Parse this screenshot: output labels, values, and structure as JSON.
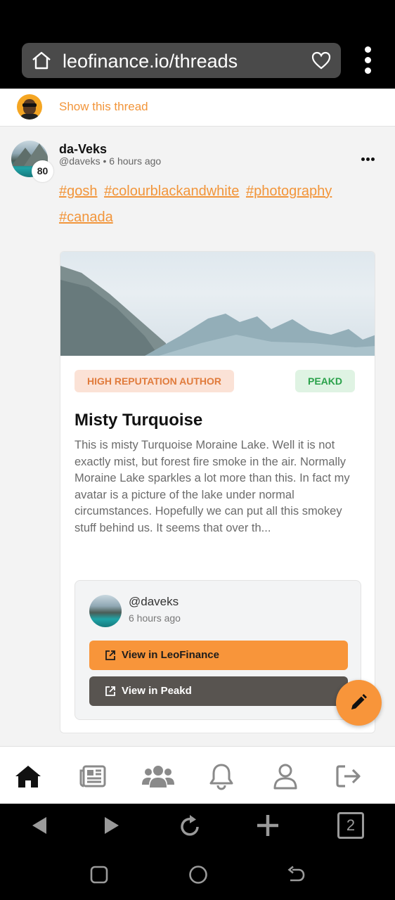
{
  "browser": {
    "url": "leofinance.io/threads",
    "tab_count": "2"
  },
  "thread_link": {
    "label": "Show this thread"
  },
  "post": {
    "author_name": "da-Veks",
    "author_handle": "@daveks",
    "separator": "•",
    "time_ago": "6 hours ago",
    "reputation": "80",
    "tags": [
      "#gosh",
      "#colourblackandwhite",
      "#photography",
      "#canada"
    ]
  },
  "card": {
    "badge_reputation": "HIGH REPUTATION AUTHOR",
    "badge_source": "PEAKD",
    "title": "Misty Turquoise",
    "body": "This is misty Turquoise Moraine Lake. Well it is not exactly mist, but forest fire smoke in the air. Normally Moraine Lake sparkles a lot more than this. In fact my avatar is a picture of the lake under normal circumstances. Hopefully we can put all this smokey stuff behind us. It seems that over th...",
    "author_handle": "@daveks",
    "time_ago": "6 hours ago",
    "btn_leo": "View in LeoFinance",
    "btn_peakd": "View in Peakd"
  },
  "colors": {
    "accent": "#f8953a",
    "tag": "#f2953a",
    "peakd_button": "#585450"
  },
  "nav_icons": [
    "home-icon",
    "newspaper-icon",
    "users-icon",
    "bell-icon",
    "profile-icon",
    "logout-icon"
  ]
}
